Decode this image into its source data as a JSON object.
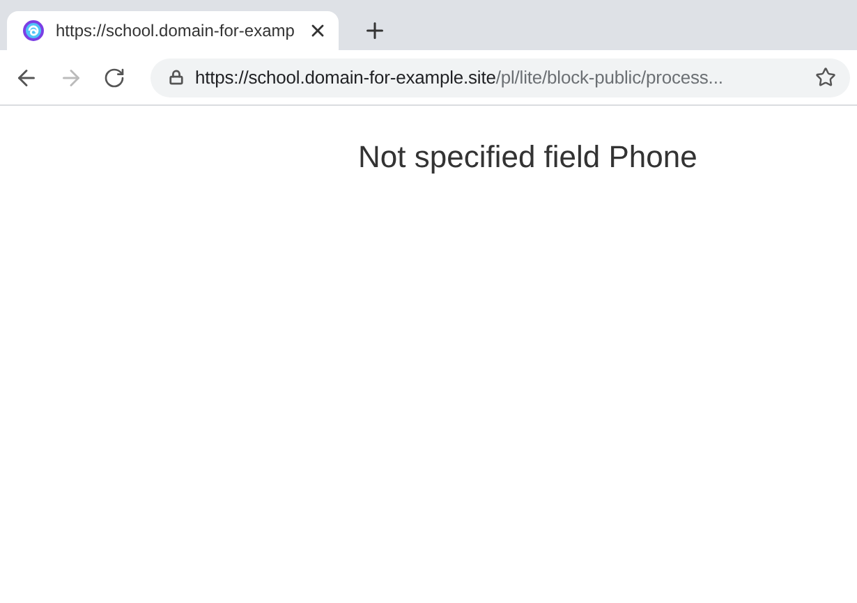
{
  "tabs": [
    {
      "title": "https://school.domain-for-examp",
      "selected": true
    }
  ],
  "toolbar": {
    "back": {
      "disabled": false
    },
    "forward": {
      "disabled": true
    }
  },
  "address_bar": {
    "host": "https://school.domain-for-example.site",
    "path": "/pl/lite/block-public/process..."
  },
  "page": {
    "heading": "Not specified field Phone"
  }
}
